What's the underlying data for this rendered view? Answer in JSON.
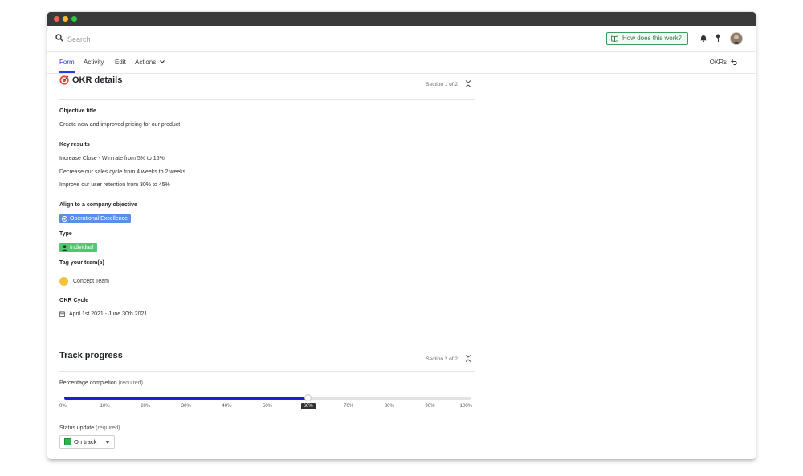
{
  "colors": {
    "accent": "#2a3bd6",
    "slider_fill": "#1b22c9",
    "help_green": "#3e9c5b",
    "tag_blue": "#5b8fe6",
    "tag_green": "#4ec773",
    "status_green": "#2cb34a",
    "team_dot": "#f5c33b"
  },
  "topbar": {
    "search_placeholder": "Search",
    "help_label": "How does this work?",
    "icons": [
      "search-icon",
      "book-icon",
      "bell-icon",
      "pin-icon",
      "avatar"
    ]
  },
  "tabs": [
    {
      "label": "Form",
      "active": true
    },
    {
      "label": "Activity",
      "active": false
    },
    {
      "label": "Edit",
      "active": false
    },
    {
      "label": "Actions",
      "active": false
    }
  ],
  "okrs_link": "OKRs",
  "section1": {
    "title": "OKR details",
    "meta": "Section 1 of 2",
    "objective_label": "Objective title",
    "objective_value": "Create new and improved pricing for our product",
    "key_results_label": "Key results",
    "key_results": [
      "Increase Close - Win rate from 5% to 15%",
      "Decrease our sales cycle from 4 weeks to 2 weeks",
      "Improve our user retention from 30% to 45%"
    ],
    "align_label": "Align to a company objective",
    "align_value": "Operational Excellence",
    "type_label": "Type",
    "type_value": "Individual",
    "teams_label": "Tag your team(s)",
    "team_value": "Concept Team",
    "cycle_label": "OKR Cycle",
    "cycle_value": "April 1st 2021 - June 30th 2021"
  },
  "section2": {
    "title": "Track progress",
    "meta": "Section 2 of 2",
    "completion_label": "Percentage completion",
    "required": "(required)",
    "completion_value": 60,
    "ticks": [
      "0%",
      "10%",
      "20%",
      "30%",
      "40%",
      "50%",
      "60%",
      "70%",
      "80%",
      "90%",
      "100%"
    ],
    "status_label": "Status update",
    "status_value": "On track"
  }
}
